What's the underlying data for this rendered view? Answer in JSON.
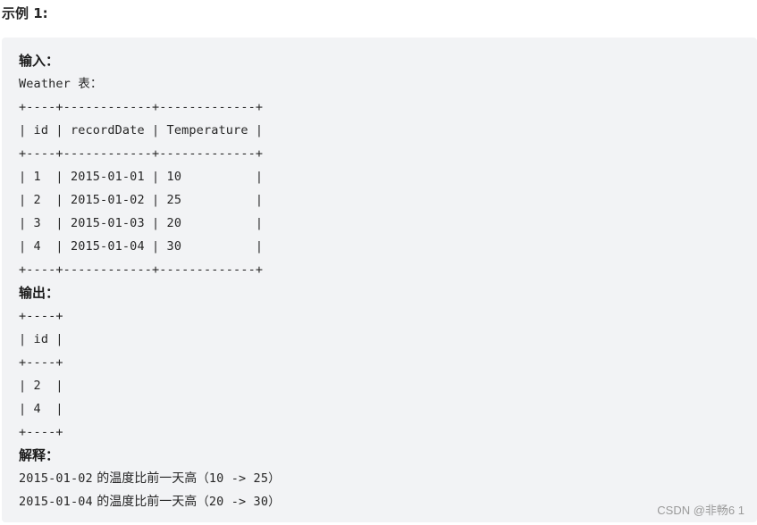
{
  "example": {
    "heading": "示例 1:",
    "input_label": "输入：",
    "table_caption": "Weather 表：",
    "input_table": {
      "columns": [
        "id",
        "recordDate",
        "Temperature"
      ],
      "rows": [
        [
          "1",
          "2015-01-01",
          "10"
        ],
        [
          "2",
          "2015-01-02",
          "25"
        ],
        [
          "3",
          "2015-01-03",
          "20"
        ],
        [
          "4",
          "2015-01-04",
          "30"
        ]
      ],
      "ascii_lines": [
        "+----+------------+-------------+",
        "| id | recordDate | Temperature |",
        "+----+------------+-------------+",
        "| 1  | 2015-01-01 | 10          |",
        "| 2  | 2015-01-02 | 25          |",
        "| 3  | 2015-01-03 | 20          |",
        "| 4  | 2015-01-04 | 30          |",
        "+----+------------+-------------+"
      ]
    },
    "output_label": "输出：",
    "output_table": {
      "columns": [
        "id"
      ],
      "rows": [
        [
          "2"
        ],
        [
          "4"
        ]
      ],
      "ascii_lines": [
        "+----+",
        "| id |",
        "+----+",
        "| 2  |",
        "| 4  |",
        "+----+"
      ]
    },
    "explanation_label": "解释：",
    "explanation_lines": [
      {
        "date": "2015-01-02",
        "text": " 的温度比前一天高",
        "detail": "（10 -> 25）"
      },
      {
        "date": "2015-01-04",
        "text": " 的温度比前一天高",
        "detail": "（20 -> 30）"
      }
    ]
  },
  "watermark": "CSDN @非畅6 1"
}
